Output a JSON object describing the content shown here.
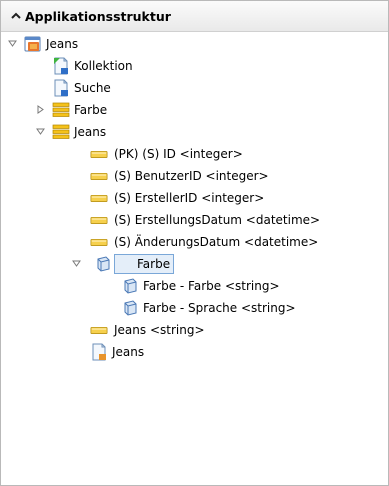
{
  "header": {
    "title": "Applikationsstruktur"
  },
  "tree": {
    "root": {
      "label": "Jeans"
    },
    "kollektion": {
      "label": "Kollektion"
    },
    "suche": {
      "label": "Suche"
    },
    "farbe_table": {
      "label": "Farbe"
    },
    "jeans_table": {
      "label": "Jeans"
    },
    "fields": [
      {
        "label": "(PK) (S) ID <integer>"
      },
      {
        "label": "(S) BenutzerID <integer>"
      },
      {
        "label": "(S) ErstellerID <integer>"
      },
      {
        "label": "(S) ErstellungsDatum <datetime>"
      },
      {
        "label": "(S) ÄnderungsDatum <datetime>"
      }
    ],
    "farbe_relation": {
      "label": "Farbe"
    },
    "farbe_fields": [
      {
        "label": "Farbe - Farbe <string>"
      },
      {
        "label": "Farbe - Sprache <string>"
      }
    ],
    "jeans_field": {
      "label": "Jeans <string>"
    },
    "jeans_form": {
      "label": "Jeans"
    }
  },
  "colors": {
    "selection_border": "#7aa7d8",
    "selection_fill": "#e4eef9",
    "field_icon": "#f2c744",
    "table_icon": "#e8b400"
  }
}
